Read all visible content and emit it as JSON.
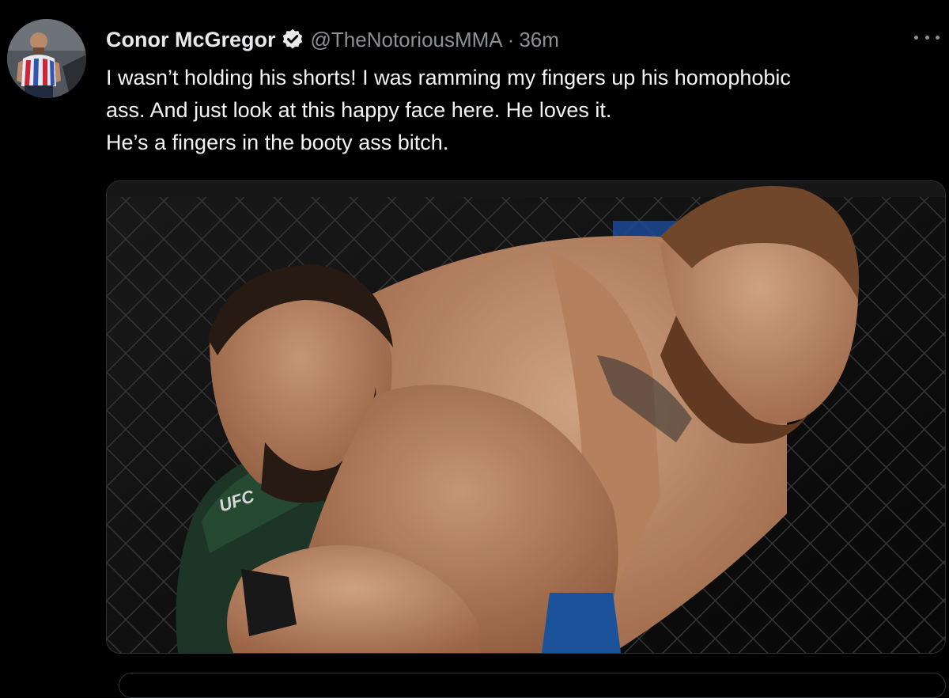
{
  "tweet": {
    "author": {
      "display_name": "Conor McGregor",
      "handle": "@TheNotoriousMMA",
      "verified": true
    },
    "separator": "·",
    "timestamp": "36m",
    "text_lines": [
      "I wasn’t holding his shorts! I was ramming my fingers up his homophobic",
      "ass. And just look at this happy face here. He loves it.",
      "He’s a fingers in the booty ass bitch."
    ],
    "media": {
      "type": "photo",
      "visible_text": "UFC"
    }
  },
  "icons": {
    "verified": "verified-badge-icon",
    "more": "more-options-icon"
  },
  "colors": {
    "background": "#000000",
    "text_primary": "#e7e9ea",
    "text_secondary": "#8b9196",
    "border": "#2f3336",
    "verified_badge": "#e7e9ea"
  }
}
